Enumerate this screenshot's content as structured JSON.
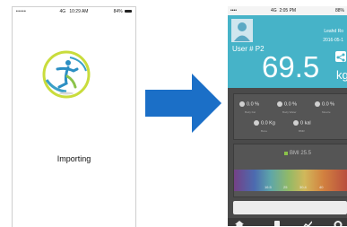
{
  "left_phone": {
    "status": {
      "carrier": "•••••",
      "network": "4G",
      "time": "10:29 AM",
      "battery": "84%"
    },
    "message": "Importing"
  },
  "right_phone": {
    "status": {
      "carrier": "••••",
      "network": "4G",
      "time": "2:05 PM",
      "battery": "88%"
    },
    "header": {
      "name": "Leahd Ro",
      "date": "2016-05-1",
      "user": "User # P2",
      "weight": "69.5",
      "unit": "kg"
    },
    "metrics": [
      {
        "value": "0.0 %",
        "label": "Body Fat"
      },
      {
        "value": "0.0 %",
        "label": "Body Water"
      },
      {
        "value": "0.0 %",
        "label": "Muscle"
      },
      {
        "value": "0.0 Kg",
        "label": "Bone"
      },
      {
        "value": "0 kal",
        "label": "BMR"
      }
    ],
    "bmi": {
      "label": "BMI 25.5",
      "scale": [
        "16.5",
        "25",
        "30.4",
        "40"
      ]
    }
  },
  "colors": {
    "accent": "#46b3c8",
    "arrow": "#1b6fc7",
    "dark": "#4a4a4a"
  }
}
